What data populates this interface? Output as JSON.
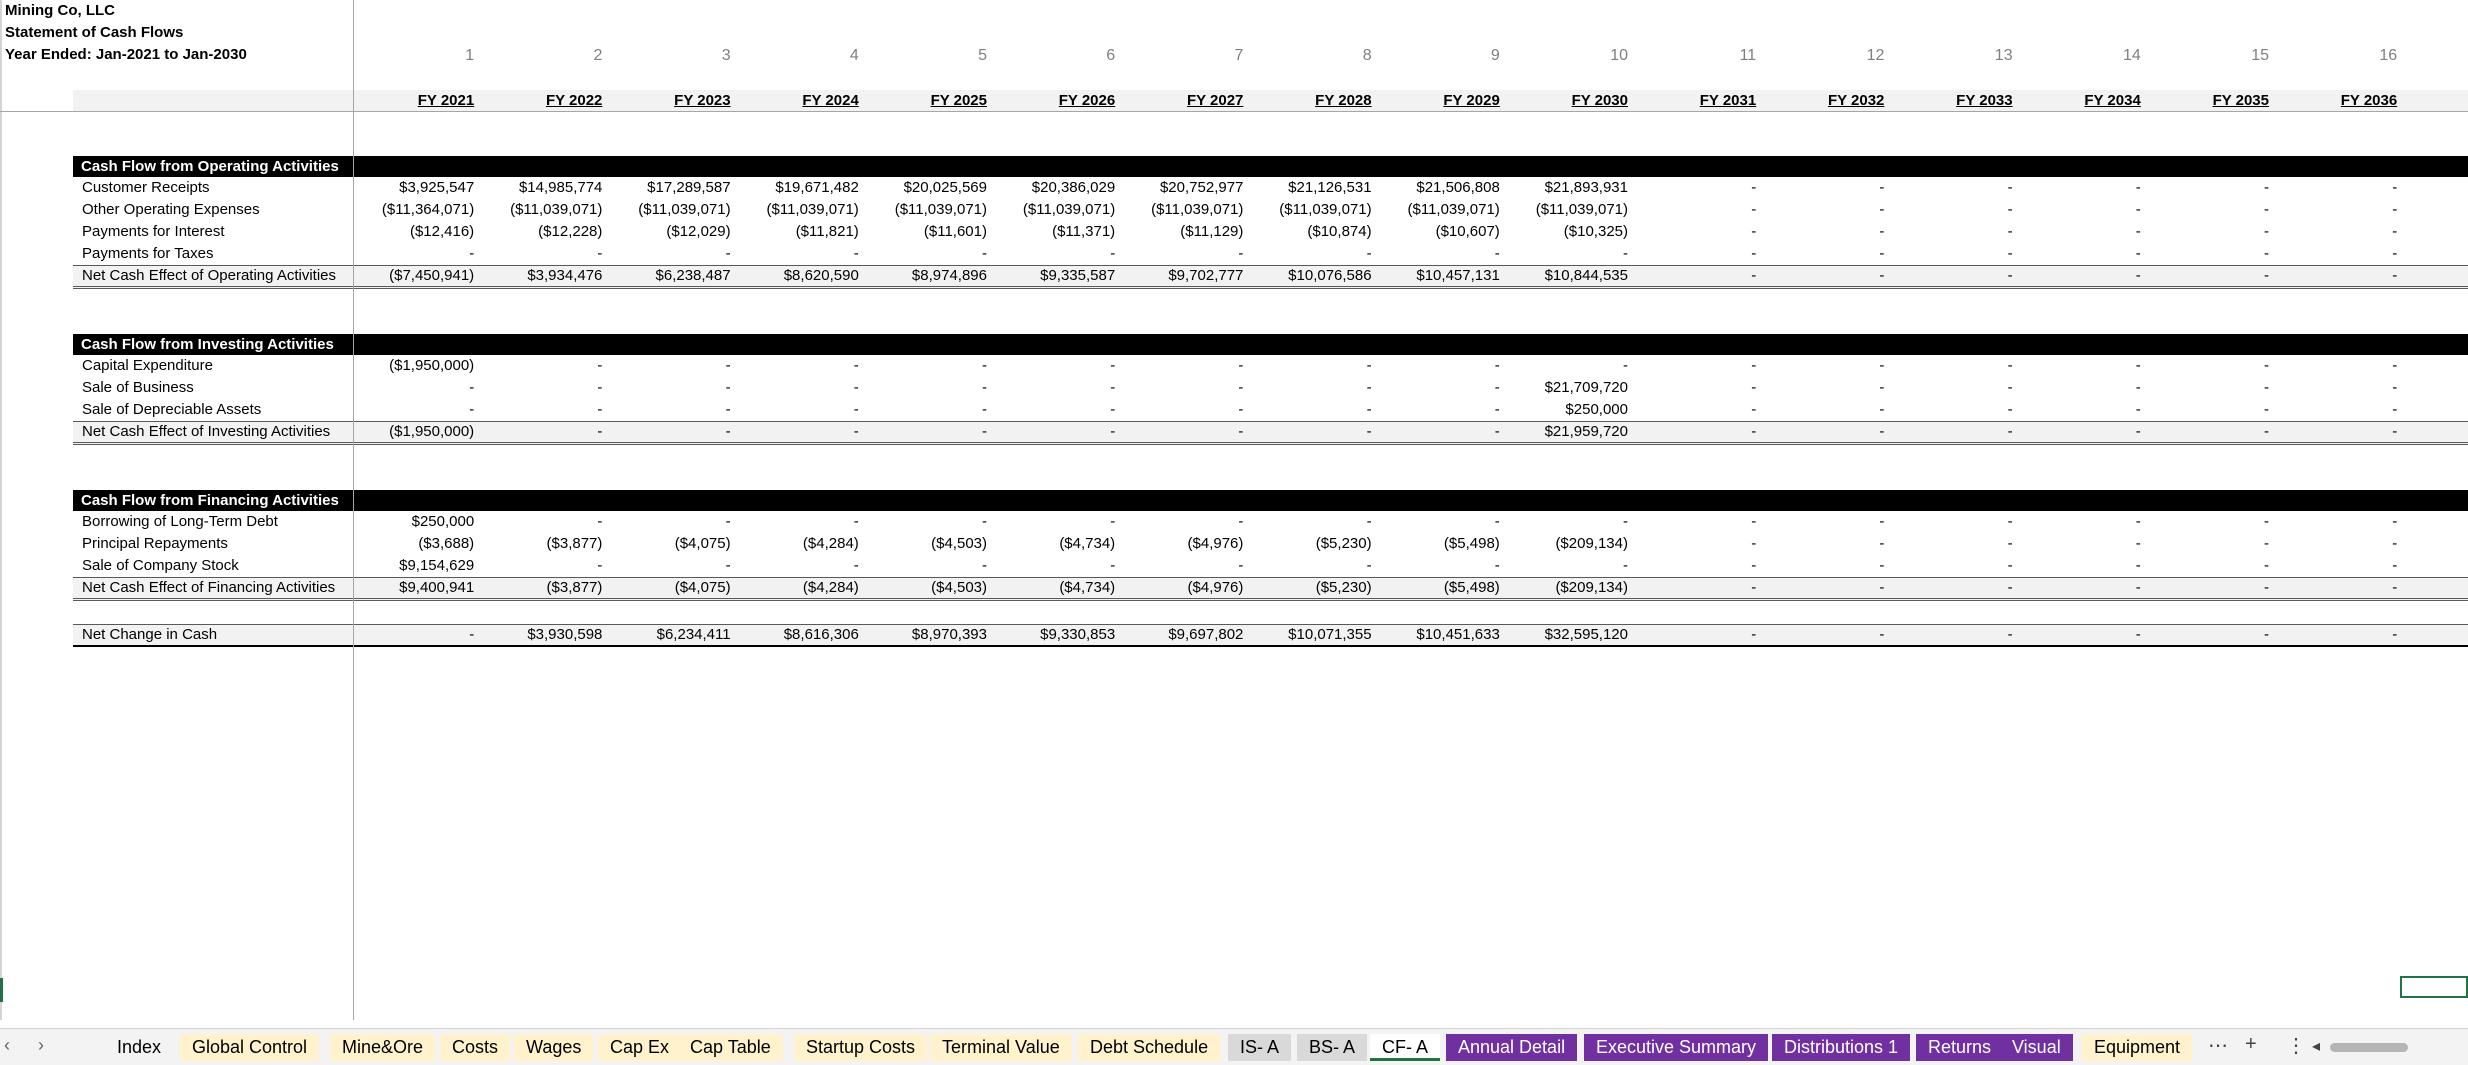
{
  "header": {
    "company": "Mining Co, LLC",
    "statement": "Statement of Cash Flows",
    "period": "Year Ended: Jan-2021 to Jan-2030"
  },
  "column_numbers": [
    "1",
    "2",
    "3",
    "4",
    "5",
    "6",
    "7",
    "8",
    "9",
    "10",
    "11",
    "12",
    "13",
    "14",
    "15",
    "16"
  ],
  "fiscal_years": [
    "FY 2021",
    "FY 2022",
    "FY 2023",
    "FY 2024",
    "FY 2025",
    "FY 2026",
    "FY 2027",
    "FY 2028",
    "FY 2029",
    "FY 2030",
    "FY 2031",
    "FY 2032",
    "FY 2033",
    "FY 2034",
    "FY 2035",
    "FY 2036"
  ],
  "sections": {
    "operating": {
      "title": "Cash Flow from Operating Activities",
      "rows": [
        {
          "label": "Customer Receipts",
          "values": [
            "$3,925,547",
            "$14,985,774",
            "$17,289,587",
            "$19,671,482",
            "$20,025,569",
            "$20,386,029",
            "$20,752,977",
            "$21,126,531",
            "$21,506,808",
            "$21,893,931",
            "-",
            "-",
            "-",
            "-",
            "-",
            "-"
          ]
        },
        {
          "label": "Other Operating Expenses",
          "values": [
            "($11,364,071)",
            "($11,039,071)",
            "($11,039,071)",
            "($11,039,071)",
            "($11,039,071)",
            "($11,039,071)",
            "($11,039,071)",
            "($11,039,071)",
            "($11,039,071)",
            "($11,039,071)",
            "-",
            "-",
            "-",
            "-",
            "-",
            "-"
          ]
        },
        {
          "label": "Payments for Interest",
          "values": [
            "($12,416)",
            "($12,228)",
            "($12,029)",
            "($11,821)",
            "($11,601)",
            "($11,371)",
            "($11,129)",
            "($10,874)",
            "($10,607)",
            "($10,325)",
            "-",
            "-",
            "-",
            "-",
            "-",
            "-"
          ]
        },
        {
          "label": "Payments for Taxes",
          "values": [
            "-",
            "-",
            "-",
            "-",
            "-",
            "-",
            "-",
            "-",
            "-",
            "-",
            "-",
            "-",
            "-",
            "-",
            "-",
            "-"
          ]
        }
      ],
      "total": {
        "label": "Net Cash Effect of Operating Activities",
        "values": [
          "($7,450,941)",
          "$3,934,476",
          "$6,238,487",
          "$8,620,590",
          "$8,974,896",
          "$9,335,587",
          "$9,702,777",
          "$10,076,586",
          "$10,457,131",
          "$10,844,535",
          "-",
          "-",
          "-",
          "-",
          "-",
          "-"
        ]
      }
    },
    "investing": {
      "title": "Cash Flow from Investing Activities",
      "rows": [
        {
          "label": "Capital Expenditure",
          "values": [
            "($1,950,000)",
            "-",
            "-",
            "-",
            "-",
            "-",
            "-",
            "-",
            "-",
            "-",
            "-",
            "-",
            "-",
            "-",
            "-",
            "-"
          ]
        },
        {
          "label": "Sale of Business",
          "values": [
            "-",
            "-",
            "-",
            "-",
            "-",
            "-",
            "-",
            "-",
            "-",
            "$21,709,720",
            "-",
            "-",
            "-",
            "-",
            "-",
            "-"
          ]
        },
        {
          "label": "Sale of Depreciable Assets",
          "values": [
            "-",
            "-",
            "-",
            "-",
            "-",
            "-",
            "-",
            "-",
            "-",
            "$250,000",
            "-",
            "-",
            "-",
            "-",
            "-",
            "-"
          ]
        }
      ],
      "total": {
        "label": "Net Cash Effect of Investing Activities",
        "values": [
          "($1,950,000)",
          "-",
          "-",
          "-",
          "-",
          "-",
          "-",
          "-",
          "-",
          "$21,959,720",
          "-",
          "-",
          "-",
          "-",
          "-",
          "-"
        ]
      }
    },
    "financing": {
      "title": "Cash Flow from Financing Activities",
      "rows": [
        {
          "label": "Borrowing of Long-Term Debt",
          "values": [
            "$250,000",
            "-",
            "-",
            "-",
            "-",
            "-",
            "-",
            "-",
            "-",
            "-",
            "-",
            "-",
            "-",
            "-",
            "-",
            "-"
          ]
        },
        {
          "label": "Principal Repayments",
          "values": [
            "($3,688)",
            "($3,877)",
            "($4,075)",
            "($4,284)",
            "($4,503)",
            "($4,734)",
            "($4,976)",
            "($5,230)",
            "($5,498)",
            "($209,134)",
            "-",
            "-",
            "-",
            "-",
            "-",
            "-"
          ]
        },
        {
          "label": "Sale of Company Stock",
          "values": [
            "$9,154,629",
            "-",
            "-",
            "-",
            "-",
            "-",
            "-",
            "-",
            "-",
            "-",
            "-",
            "-",
            "-",
            "-",
            "-",
            "-"
          ]
        }
      ],
      "total": {
        "label": "Net Cash Effect of Financing Activities",
        "values": [
          "$9,400,941",
          "($3,877)",
          "($4,075)",
          "($4,284)",
          "($4,503)",
          "($4,734)",
          "($4,976)",
          "($5,230)",
          "($5,498)",
          "($209,134)",
          "-",
          "-",
          "-",
          "-",
          "-",
          "-"
        ]
      }
    }
  },
  "net_change": {
    "label": "Net Change in Cash",
    "values": [
      "-",
      "$3,930,598",
      "$6,234,411",
      "$8,616,306",
      "$8,970,393",
      "$9,330,853",
      "$9,697,802",
      "$10,071,355",
      "$10,451,633",
      "$32,595,120",
      "-",
      "-",
      "-",
      "-",
      "-",
      "-"
    ]
  },
  "sheet_tabs": [
    {
      "label": "Index",
      "style": "plain"
    },
    {
      "label": "Global Control",
      "style": "yellow"
    },
    {
      "label": "Mine&Ore",
      "style": "yellow"
    },
    {
      "label": "Costs",
      "style": "yellow"
    },
    {
      "label": "Wages",
      "style": "yellow"
    },
    {
      "label": "Cap Ex",
      "style": "yellow"
    },
    {
      "label": "Cap Table",
      "style": "yellow"
    },
    {
      "label": "Startup Costs",
      "style": "yellow"
    },
    {
      "label": "Terminal Value",
      "style": "yellow"
    },
    {
      "label": "Debt Schedule",
      "style": "yellow"
    },
    {
      "label": "IS- A",
      "style": "gray"
    },
    {
      "label": "BS- A",
      "style": "gray"
    },
    {
      "label": "CF- A",
      "style": "active"
    },
    {
      "label": "Annual Detail",
      "style": "purple"
    },
    {
      "label": "Executive Summary",
      "style": "purple"
    },
    {
      "label": "Distributions 1",
      "style": "purple"
    },
    {
      "label": "Returns",
      "style": "purple"
    },
    {
      "label": "Visual",
      "style": "purple"
    },
    {
      "label": "Equipment",
      "style": "yellow"
    }
  ],
  "tab_controls": {
    "more": "⋯",
    "add": "+",
    "options": "⋮",
    "prev": "‹",
    "next": "›",
    "scroll_left": "◂"
  },
  "colors": {
    "header_band": "#000000",
    "purple_tab": "#7030a0",
    "yellow_tab": "#fff2cc",
    "gray_tab": "#d9d9d9",
    "excel_green": "#217346"
  }
}
